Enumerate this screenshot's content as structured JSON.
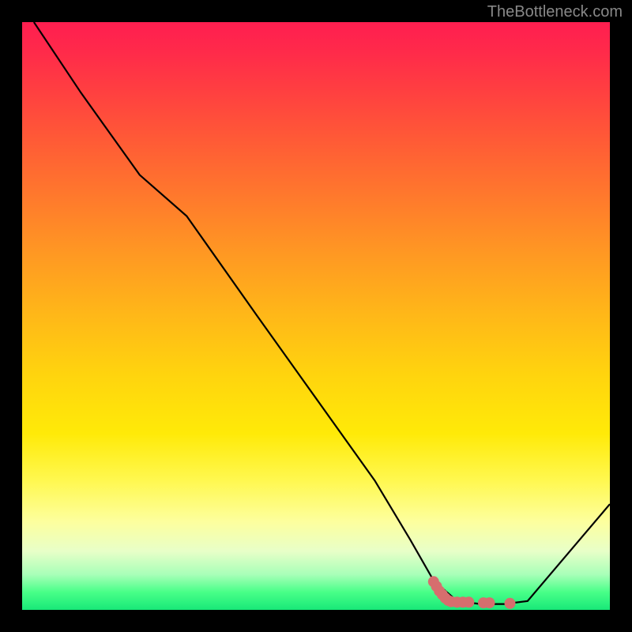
{
  "watermark": "TheBottleneck.com",
  "chart_data": {
    "type": "line",
    "title": "",
    "xlabel": "",
    "ylabel": "",
    "xlim": [
      0,
      100
    ],
    "ylim": [
      0,
      100
    ],
    "series": [
      {
        "name": "curve",
        "color": "#000000",
        "x": [
          2,
          10,
          20,
          28,
          40,
          50,
          60,
          66,
          70,
          74,
          78,
          82,
          86,
          100
        ],
        "y": [
          100,
          88,
          74,
          67,
          50,
          36,
          22,
          12,
          5,
          1.5,
          1,
          1,
          1.5,
          18
        ]
      }
    ],
    "markers": {
      "color": "#d66e6e",
      "points": [
        {
          "x": 70.0,
          "y": 4.8
        },
        {
          "x": 70.5,
          "y": 4.0
        },
        {
          "x": 71.0,
          "y": 3.2
        },
        {
          "x": 71.5,
          "y": 2.6
        },
        {
          "x": 72.0,
          "y": 2.0
        },
        {
          "x": 72.5,
          "y": 1.6
        },
        {
          "x": 73.0,
          "y": 1.4
        },
        {
          "x": 74.0,
          "y": 1.3
        },
        {
          "x": 75.0,
          "y": 1.3
        },
        {
          "x": 76.0,
          "y": 1.3
        },
        {
          "x": 78.5,
          "y": 1.2
        },
        {
          "x": 79.5,
          "y": 1.2
        },
        {
          "x": 83.0,
          "y": 1.1
        }
      ]
    },
    "gradient_stops": [
      {
        "pos": 0,
        "color": "#ff1e50"
      },
      {
        "pos": 50,
        "color": "#ffd40e"
      },
      {
        "pos": 85,
        "color": "#fdff9e"
      },
      {
        "pos": 100,
        "color": "#18e878"
      }
    ]
  }
}
